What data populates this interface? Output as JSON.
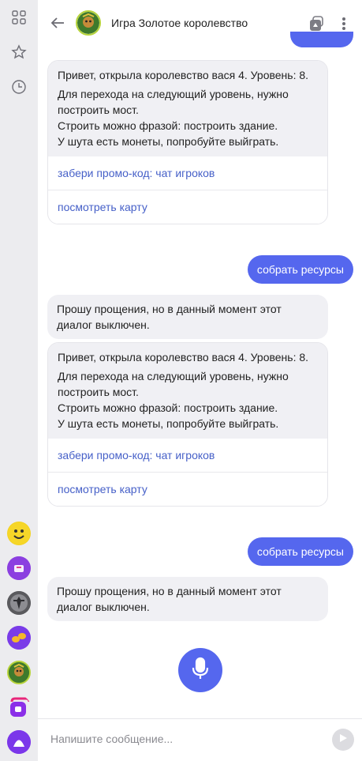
{
  "header": {
    "title": "Игра Золотое королевство"
  },
  "messages": {
    "card1": {
      "p1": "Привет, открыла королевство вася 4. Уровень: 8.",
      "p2a": "Для перехода на следующий уровень, нужно построить мост.",
      "p2b": "Строить можно фразой: построить здание.",
      "p2c": "У шута есть монеты, попробуйте выйграть.",
      "btn1": "забери промо-код: чат игроков",
      "btn2": "посмотреть карту"
    },
    "user1": "собрать ресурсы",
    "bot1": "Прошу прощения, но в данный момент этот диалог выключен.",
    "card2": {
      "p1": "Привет, открыла королевство вася 4. Уровень: 8.",
      "p2a": "Для перехода на следующий уровень, нужно построить мост.",
      "p2b": "Строить можно фразой: построить здание.",
      "p2c": "У шута есть монеты, попробуйте выйграть.",
      "btn1": "забери промо-код: чат игроков",
      "btn2": "посмотреть карту"
    },
    "user2": "собрать ресурсы",
    "bot2": "Прошу прощения, но в данный момент этот диалог выключен."
  },
  "input": {
    "placeholder": "Напишите сообщение..."
  },
  "icons": {
    "rail": [
      "grid-icon",
      "star-icon",
      "clock-icon"
    ],
    "apps": [
      "smiley-app-icon",
      "purple-app-icon",
      "figure-app-icon",
      "knot-app-icon",
      "kingdom-app-icon",
      "purple-chat-app-icon",
      "alice-app-icon"
    ],
    "header": [
      "back-arrow-icon",
      "cube-icon",
      "more-icon"
    ],
    "mic": "microphone-icon",
    "send": "send-icon"
  },
  "colors": {
    "accent": "#5567ee",
    "link": "#4660c8",
    "bubble": "#f0f0f4"
  }
}
